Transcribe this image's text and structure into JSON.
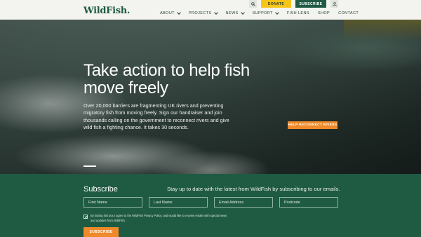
{
  "header": {
    "logo": "WildFish.",
    "nav": [
      {
        "label": "ABOUT",
        "dropdown": true
      },
      {
        "label": "PROJECTS",
        "dropdown": true
      },
      {
        "label": "NEWS",
        "dropdown": true
      },
      {
        "label": "SUPPORT",
        "dropdown": true
      },
      {
        "label": "FISH LENS",
        "dropdown": false
      },
      {
        "label": "SHOP",
        "dropdown": false
      },
      {
        "label": "CONTACT",
        "dropdown": false
      }
    ],
    "donate_label": "DONATE",
    "subscribe_label": "SUBSCRIBE",
    "icons": {
      "search": "search-icon",
      "account": "user-icon"
    }
  },
  "hero": {
    "title": "Take action to help fish move freely",
    "text": "Over 20,000 barriers are fragmenting UK rivers and preventing migratory fish from moving freely. Sign our handraiser and join thousands calling on the government to reconnect rivers and give wild fish a fighting chance. It takes 30 seconds.",
    "cta_label": "HELP RECONNECT RIVERS"
  },
  "subscribe": {
    "title": "Subscribe",
    "text": "Stay up to date with the latest from WildFish by subscribing to our emails.",
    "fields": {
      "first_name": "First Name",
      "last_name": "Last Name",
      "email": "Email Address",
      "postcode": "Postcode"
    },
    "consent_checked": true,
    "consent": "By ticking this box I agree to the WildFish Privacy Policy, and would like to receive emails with special news and updates from WildFish.",
    "submit_label": "SUBSCRIBE"
  },
  "colors": {
    "brand_green": "#1f5a43",
    "donate_yellow": "#f7c518",
    "accent_orange": "#ee8a2a",
    "header_bg": "#f3f4ef"
  }
}
